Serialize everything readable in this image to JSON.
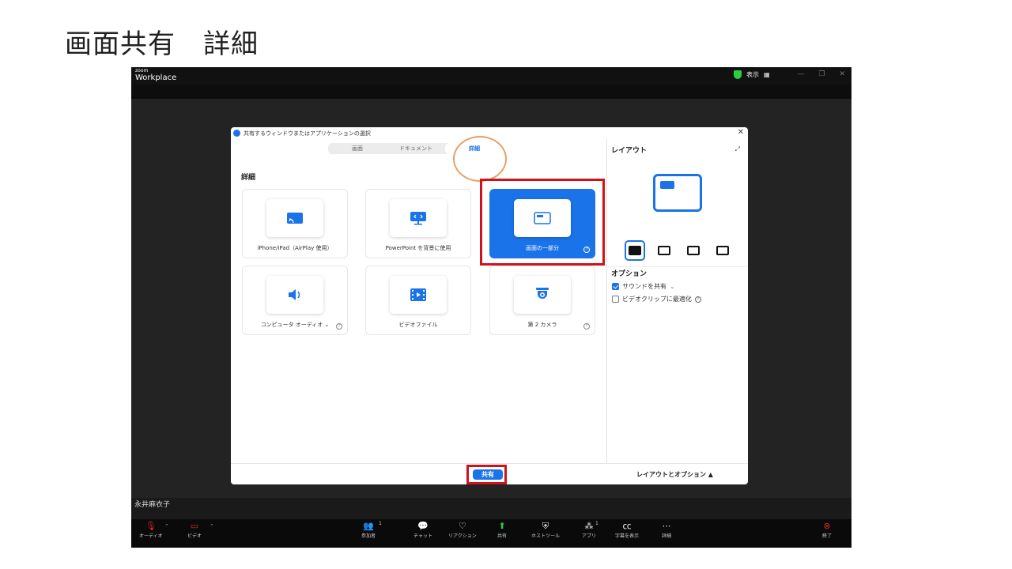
{
  "slide": {
    "title": "画面共有　詳細"
  },
  "app": {
    "brand_top": "zoom",
    "brand_bottom": "Workplace",
    "view_label": "表示",
    "participant_name": "永井麻衣子"
  },
  "dialog": {
    "title": "共有するウィンドウまたはアプリケーションの選択",
    "tabs": [
      {
        "label": "画面"
      },
      {
        "label": "ドキュメント"
      },
      {
        "label": "詳細",
        "active": true
      }
    ],
    "section_label": "詳細",
    "cards": [
      {
        "label": "iPhone/iPad（AirPlay 使用）",
        "icon": "airplay-icon"
      },
      {
        "label": "PowerPoint を背景に使用",
        "icon": "powerpoint-icon"
      },
      {
        "label": "画面の一部分",
        "icon": "screen-portion-icon",
        "selected": true,
        "help": "?"
      },
      {
        "label": "コンピュータ オーディオ",
        "icon": "speaker-icon",
        "help": "?"
      },
      {
        "label": "ビデオファイル",
        "icon": "video-file-icon"
      },
      {
        "label": "第 2 カメラ",
        "icon": "camera-icon",
        "help": "?"
      }
    ],
    "layout_title": "レイアウト",
    "options_title": "オプション",
    "option_sound": "サウンドを共有",
    "option_video": "ビデオクリップに最適化",
    "share_button": "共有",
    "layout_options_toggle": "レイアウトとオプション ▲"
  },
  "toolbar": {
    "audio": "オーディオ",
    "video": "ビデオ",
    "participants": "参加者",
    "participants_count": "1",
    "chat": "チャット",
    "reactions": "リアクション",
    "share": "共有",
    "host_tools": "ホストツール",
    "apps": "アプリ",
    "apps_count": "1",
    "captions": "字幕を表示",
    "more": "詳細",
    "end": "終了"
  },
  "colors": {
    "accent": "#1a73e8",
    "highlight_red": "#d0121b",
    "highlight_orange": "#e8a060",
    "end_red": "#e02424"
  }
}
